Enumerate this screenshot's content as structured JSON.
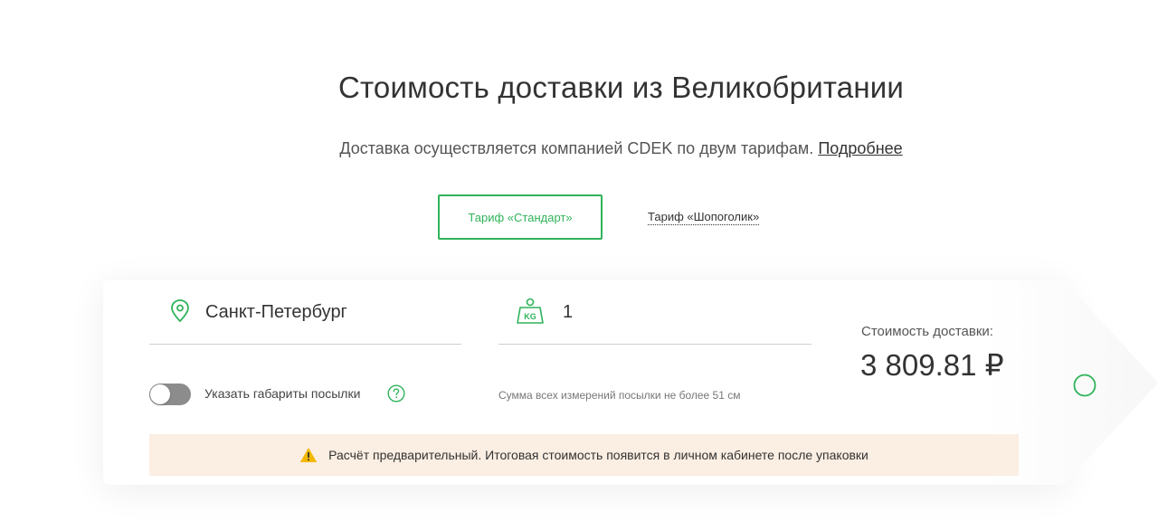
{
  "header": {
    "title": "Стоимость доставки из Великобритании",
    "subtitle_text": "Доставка осуществляется компанией CDEK по двум тарифам.",
    "more_link": "Подробнее"
  },
  "tabs": [
    {
      "label": "Тариф «Стандарт»",
      "active": true
    },
    {
      "label": "Тариф «Шопоголик»",
      "active": false
    }
  ],
  "calculator": {
    "city": {
      "value": "Санкт-Петербург",
      "icon": "location-pin-icon"
    },
    "weight": {
      "value": "1",
      "icon": "weight-kg-icon",
      "unit_badge": "KG"
    },
    "dimensions_toggle": {
      "label": "Указать габариты посылки",
      "enabled": false
    },
    "size_hint": "Сумма всех измерений посылки не более 51 см",
    "price_label": "Стоимость доставки:",
    "price_value": "3 809.81 ₽"
  },
  "notice": {
    "text": "Расчёт предварительный. Итоговая стоимость появится в личном кабинете после упаковки",
    "icon": "warning-icon"
  },
  "colors": {
    "accent": "#2fb35a",
    "notice_bg": "#fbeee2",
    "warning": "#f5b800"
  }
}
